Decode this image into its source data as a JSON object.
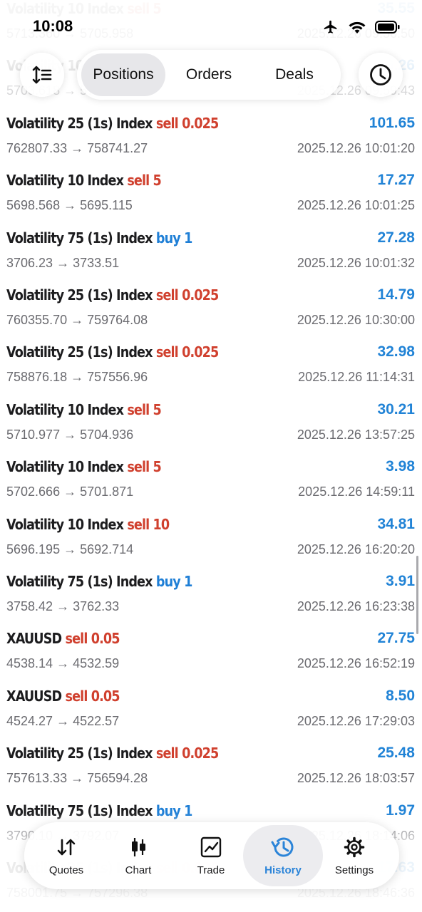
{
  "status_bar": {
    "time": "10:08",
    "icons": [
      "airplane-icon",
      "wifi-icon",
      "battery-icon"
    ]
  },
  "top_bar": {
    "sort_icon": "sort-icon",
    "history_icon": "clock-icon",
    "segments": [
      "Positions",
      "Orders",
      "Deals"
    ],
    "selected_segment": "Positions"
  },
  "deals": [
    {
      "symbol": "Volatility 10 Index",
      "side": "sell",
      "volume": "5",
      "profit": "35.55",
      "prices": "5713.360 → 5705.958",
      "time": "2025.12.26 09:56:50"
    },
    {
      "symbol": "Volatility 10 Index",
      "side": "sell",
      "volume": "5",
      "profit": "16.26",
      "prices": "5703.618 → 5700.343",
      "time": "2025.12.26 09:59:43"
    },
    {
      "symbol": "Volatility 25 (1s) Index",
      "side": "sell",
      "volume": "0.025",
      "profit": "101.65",
      "prices": "762807.33 → 758741.27",
      "time": "2025.12.26 10:01:20"
    },
    {
      "symbol": "Volatility 10 Index",
      "side": "sell",
      "volume": "5",
      "profit": "17.27",
      "prices": "5698.568 → 5695.115",
      "time": "2025.12.26 10:01:25"
    },
    {
      "symbol": "Volatility 75 (1s) Index",
      "side": "buy",
      "volume": "1",
      "profit": "27.28",
      "prices": "3706.23 → 3733.51",
      "time": "2025.12.26 10:01:32"
    },
    {
      "symbol": "Volatility 25 (1s) Index",
      "side": "sell",
      "volume": "0.025",
      "profit": "14.79",
      "prices": "760355.70 → 759764.08",
      "time": "2025.12.26 10:30:00"
    },
    {
      "symbol": "Volatility 25 (1s) Index",
      "side": "sell",
      "volume": "0.025",
      "profit": "32.98",
      "prices": "758876.18 → 757556.96",
      "time": "2025.12.26 11:14:31"
    },
    {
      "symbol": "Volatility 10 Index",
      "side": "sell",
      "volume": "5",
      "profit": "30.21",
      "prices": "5710.977 → 5704.936",
      "time": "2025.12.26 13:57:25"
    },
    {
      "symbol": "Volatility 10 Index",
      "side": "sell",
      "volume": "5",
      "profit": "3.98",
      "prices": "5702.666 → 5701.871",
      "time": "2025.12.26 14:59:11"
    },
    {
      "symbol": "Volatility 10 Index",
      "side": "sell",
      "volume": "10",
      "profit": "34.81",
      "prices": "5696.195 → 5692.714",
      "time": "2025.12.26 16:20:20"
    },
    {
      "symbol": "Volatility 75 (1s) Index",
      "side": "buy",
      "volume": "1",
      "profit": "3.91",
      "prices": "3758.42 → 3762.33",
      "time": "2025.12.26 16:23:38"
    },
    {
      "symbol": "XAUUSD",
      "side": "sell",
      "volume": "0.05",
      "profit": "27.75",
      "prices": "4538.14 → 4532.59",
      "time": "2025.12.26 16:52:19"
    },
    {
      "symbol": "XAUUSD",
      "side": "sell",
      "volume": "0.05",
      "profit": "8.50",
      "prices": "4524.27 → 4522.57",
      "time": "2025.12.26 17:29:03"
    },
    {
      "symbol": "Volatility 25 (1s) Index",
      "side": "sell",
      "volume": "0.025",
      "profit": "25.48",
      "prices": "757613.33 → 756594.28",
      "time": "2025.12.26 18:03:57"
    },
    {
      "symbol": "Volatility 75 (1s) Index",
      "side": "buy",
      "volume": "1",
      "profit": "1.97",
      "prices": "3790.10 → 3792.07",
      "time": "2025.12.26 18:14:06"
    },
    {
      "symbol": "Volatility 25 (1s) Index",
      "side": "sell",
      "volume": "0.025",
      "profit": "17.63",
      "prices": "758001.75 → 757296.38",
      "time": "2025.12.26 18:46:36"
    }
  ],
  "tab_bar": {
    "tabs": [
      {
        "label": "Quotes",
        "icon": "arrows-up-down-icon"
      },
      {
        "label": "Chart",
        "icon": "candlestick-icon"
      },
      {
        "label": "Trade",
        "icon": "trend-chart-icon"
      },
      {
        "label": "History",
        "icon": "history-icon"
      },
      {
        "label": "Settings",
        "icon": "gear-icon"
      }
    ],
    "active_tab": "History"
  },
  "colors": {
    "sell": "#d0402e",
    "buy": "#1f7fd6",
    "profit": "#2183d6",
    "active_tab": "#2b84d8"
  }
}
